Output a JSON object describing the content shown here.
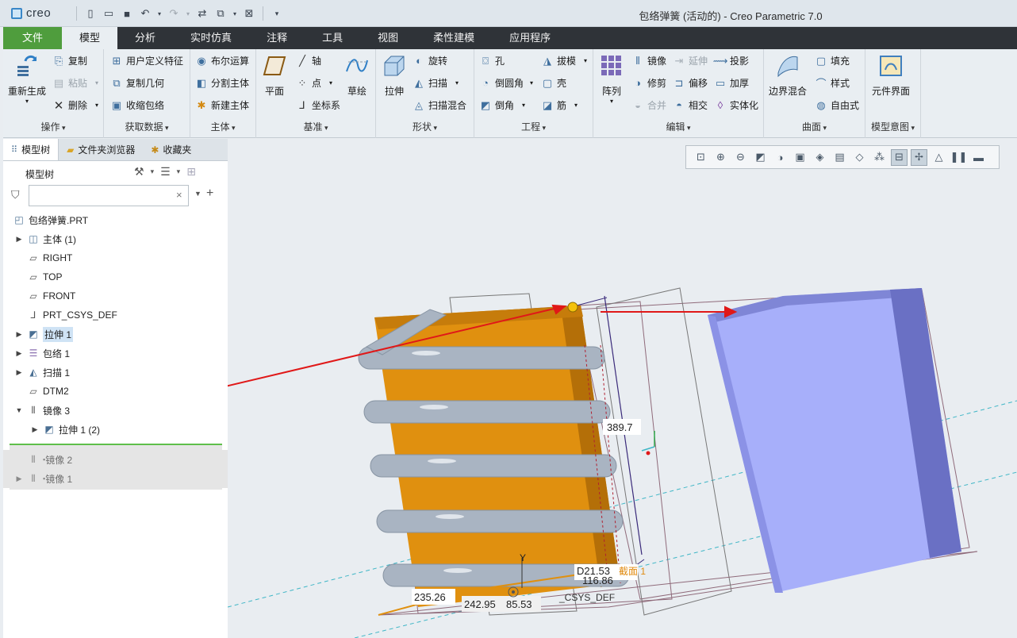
{
  "app": {
    "logo": "creo",
    "title": "包络弹簧 (活动的) - Creo Parametric 7.0"
  },
  "ribbon_tabs": [
    "文件",
    "模型",
    "分析",
    "实时仿真",
    "注释",
    "工具",
    "视图",
    "柔性建模",
    "应用程序"
  ],
  "groups": {
    "operations": {
      "label": "操作",
      "regen": "重新生成",
      "copy": "复制",
      "paste": "粘贴",
      "delete": "删除"
    },
    "getdata": {
      "label": "获取数据",
      "udf": "用户定义特征",
      "copygeom": "复制几何",
      "shrink": "收缩包络"
    },
    "body": {
      "label": "主体",
      "boolean": "布尔运算",
      "split": "分割主体",
      "newbody": "新建主体"
    },
    "datum": {
      "label": "基准",
      "plane": "平面",
      "axis": "轴",
      "point": "点",
      "csys": "坐标系",
      "sketch": "草绘"
    },
    "shapes": {
      "label": "形状",
      "extrude": "拉伸",
      "revolve": "旋转",
      "sweep": "扫描",
      "sweepblend": "扫描混合"
    },
    "engineering": {
      "label": "工程",
      "hole": "孔",
      "round": "倒圆角",
      "chamfer": "倒角",
      "draft": "拔模",
      "shell": "壳",
      "rib": "筋"
    },
    "editing": {
      "label": "编辑",
      "pattern": "阵列",
      "mirror": "镜像",
      "trim": "修剪",
      "merge": "合并",
      "extend": "延伸",
      "offset": "偏移",
      "intersect": "相交",
      "project": "投影",
      "thicken": "加厚",
      "solidify": "实体化"
    },
    "surfaces": {
      "label": "曲面",
      "boundary": "边界混合",
      "fill": "填充",
      "style": "样式",
      "freestyle": "自由式"
    },
    "intent": {
      "label": "模型意图",
      "component": "元件界面"
    }
  },
  "panel": {
    "tabs": [
      "模型树",
      "文件夹浏览器",
      "收藏夹"
    ],
    "title": "模型树",
    "search_value": ""
  },
  "tree": [
    {
      "label": "包络弹簧.PRT",
      "icon": "part-icon"
    },
    {
      "label": "主体 (1)",
      "icon": "body-icon"
    },
    {
      "label": "RIGHT",
      "icon": "datum-plane-icon"
    },
    {
      "label": "TOP",
      "icon": "datum-plane-icon"
    },
    {
      "label": "FRONT",
      "icon": "datum-plane-icon"
    },
    {
      "label": "PRT_CSYS_DEF",
      "icon": "csys-icon"
    },
    {
      "label": "拉伸 1",
      "icon": "extrude-icon"
    },
    {
      "label": "包络 1",
      "icon": "wrap-icon"
    },
    {
      "label": "扫描 1",
      "icon": "sweep-icon"
    },
    {
      "label": "DTM2",
      "icon": "datum-plane-icon"
    },
    {
      "label": "镜像 3",
      "icon": "mirror-icon"
    },
    {
      "label": "拉伸 1 (2)",
      "icon": "extrude-icon"
    },
    {
      "label": "镜像 2",
      "icon": "mirror-icon"
    },
    {
      "label": "镜像 1",
      "icon": "mirror-icon"
    }
  ],
  "viewport": {
    "dim_height": "389.7",
    "dim_a": "235.26",
    "dim_b": "242.95",
    "dim_c": "85.53",
    "dim_d": "116.86",
    "dim_e": "D21.53",
    "label_y": "Y",
    "label_plane": "截面 1",
    "label_csys": "_CSYS_DEF"
  },
  "colors": {
    "file_tab": "#4f9d3d",
    "tab_bar": "#2f3338",
    "orange_body": "#e08f10",
    "blue_body": "#a4acf6",
    "arrow": "#e01818"
  }
}
